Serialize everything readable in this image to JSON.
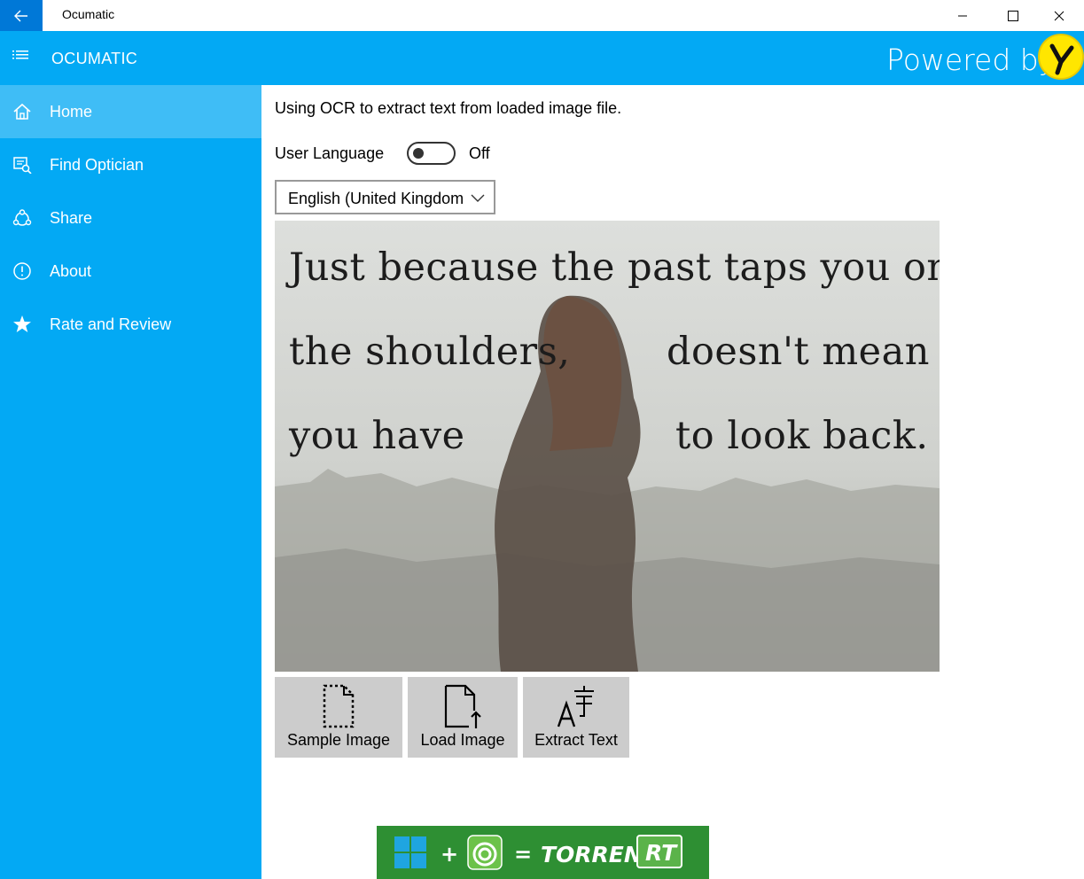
{
  "window": {
    "title": "Ocumatic"
  },
  "header": {
    "app_name": "OCUMATIC",
    "powered_by": "Powered by"
  },
  "sidebar": {
    "items": [
      {
        "label": "Home",
        "icon": "home-icon",
        "active": true
      },
      {
        "label": "Find Optician",
        "icon": "find-optician-icon",
        "active": false
      },
      {
        "label": "Share",
        "icon": "share-icon",
        "active": false
      },
      {
        "label": "About",
        "icon": "info-icon",
        "active": false
      },
      {
        "label": "Rate and Review",
        "icon": "star-icon",
        "active": false
      }
    ]
  },
  "main": {
    "description": "Using OCR to extract text from loaded image file.",
    "user_language_label": "User Language",
    "toggle_state": "Off",
    "language_selected": "English (United Kingdom)",
    "image_text": [
      "Just because the past taps you on",
      "the shoulders,",
      "doesn't mean",
      "you have",
      "to look back."
    ],
    "buttons": {
      "sample_image": "Sample Image",
      "load_image": "Load Image",
      "extract_text": "Extract Text"
    }
  },
  "ad": {
    "plus": "+",
    "equals": "=",
    "torrent": "TORRENT",
    "rt": "RT"
  },
  "colors": {
    "accent": "#03a9f4",
    "sidebar_active": "#3fbdf6",
    "back_button": "#0078d7",
    "tool_button": "#cccccc",
    "ad_green": "#2e8f33",
    "logo_yellow": "#ffe600"
  }
}
